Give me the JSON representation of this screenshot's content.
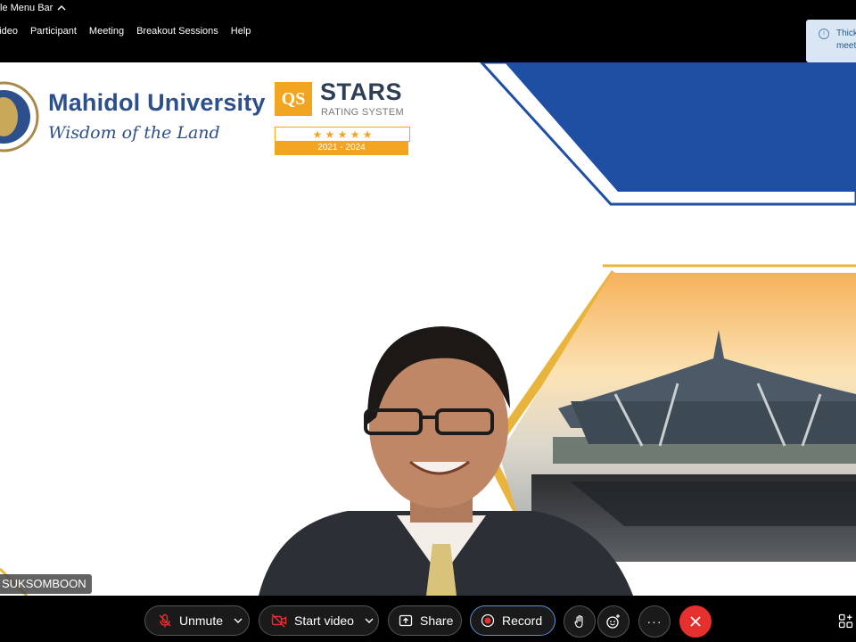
{
  "menu_bar": {
    "hide_label": "le Menu Bar",
    "items": [
      "Video",
      "Participant",
      "Meeting",
      "Breakout Sessions",
      "Help"
    ]
  },
  "notification": {
    "text": "Thick\nmeet"
  },
  "slide": {
    "university_name": "Mahidol University",
    "tagline": "Wisdom of the Land",
    "qs_logo": "QS",
    "qs_stars": "STARS",
    "qs_rating_system": "RATING SYSTEM",
    "qs_star_glyphs": "★ ★ ★ ★ ★",
    "qs_years": "2021 - 2024"
  },
  "participant": {
    "name_tag": "SUKSOMBOON"
  },
  "toolbar": {
    "unmute_label": "Unmute",
    "start_video_label": "Start video",
    "share_label": "Share",
    "record_label": "Record",
    "more_label": "···"
  },
  "colors": {
    "brand_blue": "#1f4fa3",
    "qs_orange": "#f2a521",
    "end_red": "#e5302e"
  }
}
